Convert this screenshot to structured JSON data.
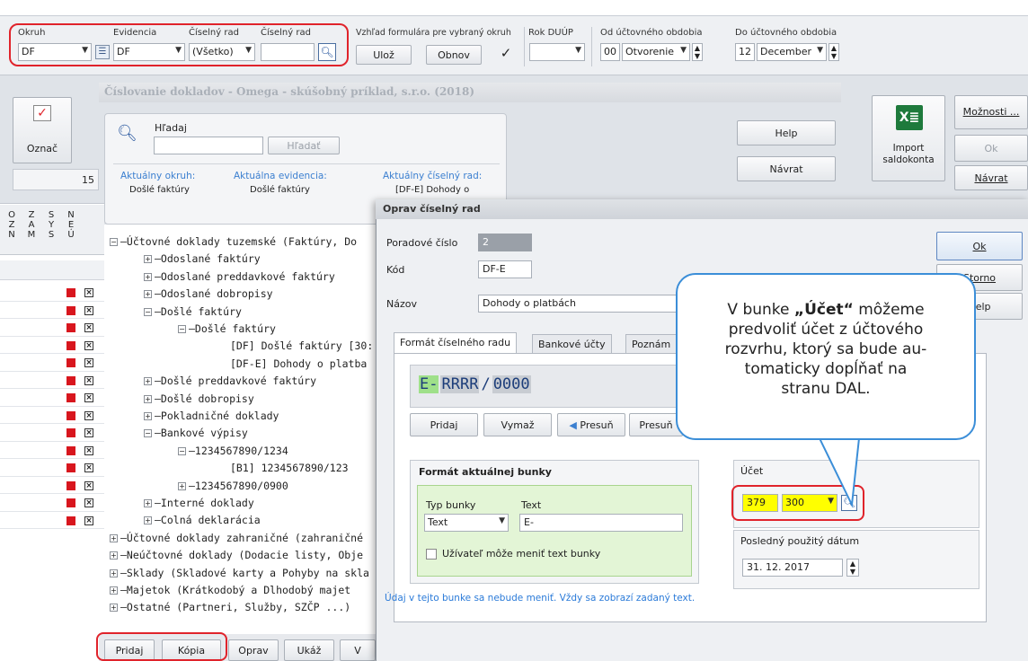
{
  "toolbar": {
    "okruh_label": "Okruh",
    "okruh_value": "DF",
    "evidencia_label": "Evidencia",
    "evidencia_value": "DF",
    "ciselny_rad_label": "Číselný rad",
    "ciselny_rad_value": "(Všetko)",
    "ciselny_rad2_label": "Číselný rad",
    "ciselny_rad2_value": "",
    "vzhlad_label": "Vzhľad formulára pre vybraný okruh",
    "uloz": "Ulož",
    "obnov": "Obnov",
    "check_mark": "✓",
    "rok_label": "Rok DUÚP",
    "rok_value": "",
    "od_label": "Od účtovného obdobia",
    "od_num": "00",
    "od_value": "Otvorenie",
    "do_label": "Do účtovného obdobia",
    "do_num": "12",
    "do_value": "December"
  },
  "group_title": "Číslovanie dokladov - Omega - skúšobný príklad, s.r.o. (2018)",
  "left": {
    "oznac": "Označ",
    "count": "15",
    "columns": [
      "O\nZ\nN",
      "Z\nA\nM",
      "S\nY\nS",
      "N\nE\nÚ"
    ]
  },
  "search": {
    "label": "Hľadaj",
    "button": "Hľadať",
    "placeholder": ""
  },
  "current": {
    "okruh_label": "Aktuálny okruh:",
    "okruh_value": "Došlé faktúry",
    "evidencia_label": "Aktuálna evidencia:",
    "evidencia_value": "Došlé faktúry",
    "rad_label": "Aktuálny číselný rad:",
    "rad_value": "[DF-E] Dohody o"
  },
  "right_buttons": {
    "help": "Help",
    "navrat": "Návrat",
    "import_line1": "Import",
    "import_line2": "saldokonta",
    "moznosti": "Možnosti ...",
    "ok": "Ok",
    "navrat2": "Návrat"
  },
  "tree": [
    {
      "text": "Účtovné doklady tuzemské (Faktúry, Do",
      "exp": "−",
      "level": 0
    },
    {
      "text": "Odoslané faktúry",
      "exp": "+",
      "level": 1
    },
    {
      "text": "Odoslané preddavkové faktúry",
      "exp": "+",
      "level": 1
    },
    {
      "text": "Odoslané dobropisy",
      "exp": "+",
      "level": 1
    },
    {
      "text": "Došlé faktúry",
      "exp": "−",
      "level": 1
    },
    {
      "text": "Došlé faktúry",
      "exp": "−",
      "level": 2
    },
    {
      "text": "[DF] Došlé faktúry [30:",
      "exp": "",
      "level": 3
    },
    {
      "text": "[DF-E] Dohody o platba",
      "exp": "",
      "level": 3
    },
    {
      "text": "Došlé preddavkové faktúry",
      "exp": "+",
      "level": 1
    },
    {
      "text": "Došlé dobropisy",
      "exp": "+",
      "level": 1
    },
    {
      "text": "Pokladničné doklady",
      "exp": "+",
      "level": 1
    },
    {
      "text": "Bankové výpisy",
      "exp": "−",
      "level": 1
    },
    {
      "text": "1234567890/1234",
      "exp": "−",
      "level": 2
    },
    {
      "text": "[B1] 1234567890/123",
      "exp": "",
      "level": 3
    },
    {
      "text": "1234567890/0900",
      "exp": "+",
      "level": 2
    },
    {
      "text": "Interné doklady",
      "exp": "+",
      "level": 1
    },
    {
      "text": "Colná deklarácia",
      "exp": "+",
      "level": 1
    },
    {
      "text": "Účtovné doklady zahraničné (zahraničné",
      "exp": "+",
      "level": 0
    },
    {
      "text": "Neúčtovné doklady (Dodacie listy, Obje",
      "exp": "+",
      "level": 0
    },
    {
      "text": "Sklady (Skladové karty a Pohyby na skla",
      "exp": "+",
      "level": 0
    },
    {
      "text": "Majetok (Krátkodobý a Dlhodobý majet",
      "exp": "+",
      "level": 0
    },
    {
      "text": "Ostatné (Partneri, Služby, SZČP ...)",
      "exp": "+",
      "level": 0
    }
  ],
  "bottom_buttons": {
    "pridaj": "Pridaj",
    "kopia": "Kópia",
    "oprav": "Oprav",
    "ukaz": "Ukáž",
    "v": "V"
  },
  "dialog": {
    "title": "Oprav číselný rad",
    "poradove_label": "Poradové číslo",
    "poradove_value": "2",
    "kod_label": "Kód",
    "kod_value": "DF-E",
    "nazov_label": "Názov",
    "nazov_value": "Dohody o platbách",
    "tabs": [
      "Formát číselného radu",
      "Bankové účty",
      "Poznám"
    ],
    "format_preview_1": "E-",
    "format_preview_2": "RRRR",
    "format_preview_3": "/",
    "format_preview_4": "0000",
    "pridaj": "Pridaj",
    "vymaz": "Vymaž",
    "presun1": "Presuň",
    "presun2": "Presuň",
    "format_cell_title": "Formát aktuálnej bunky",
    "typ_label": "Typ bunky",
    "typ_value": "Text",
    "text_label": "Text",
    "text_value": "E-",
    "checkbox_label": "Užívateľ môže meniť text bunky",
    "ucet_label": "Účet",
    "ucet_1": "379",
    "ucet_2": "300",
    "datum_label": "Posledný použitý dátum",
    "datum_value": "31. 12. 2017",
    "info": "Údaj v tejto bunke sa nebude meniť. Vždy sa zobrazí zadaný text.",
    "ok": "Ok",
    "storno": "Storno",
    "help": "Help"
  },
  "callout": {
    "line1_pre": "V bunke ",
    "line1_bold": "„Účet“",
    "line1_post": " môžeme",
    "line2": "predvoliť účet z účtového",
    "line3": "rozvrhu, ktorý sa bude au-",
    "line4": "tomaticky dopĺňať na",
    "line5": "stranu DAL."
  },
  "colors": {
    "highlight_red": "#e0232b",
    "callout_blue": "#3b8ed8",
    "account_yellow": "#ffff00",
    "format_green": "#e3f5d6"
  }
}
